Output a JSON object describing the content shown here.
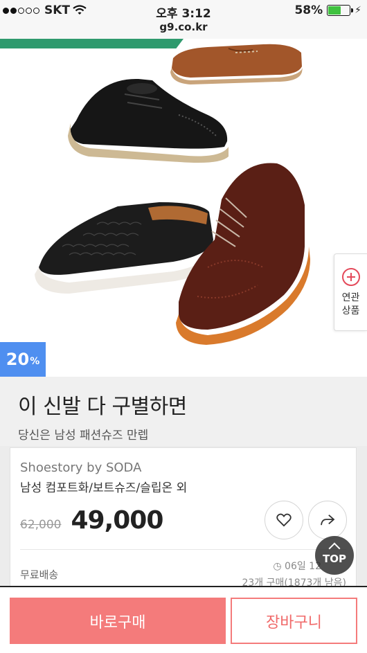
{
  "status_bar": {
    "carrier": "SKT",
    "time": "오후 3:12",
    "battery_percent": "58%",
    "battery_level": 0.58,
    "signal_bars": 2
  },
  "browser": {
    "url": "g9.co.kr"
  },
  "hero": {
    "discount_value": "20",
    "discount_unit": "%",
    "related_tab": {
      "line1": "연관",
      "line2": "상품",
      "icon": "plus-circle-icon"
    }
  },
  "title": {
    "main": "이 신발 다 구별하면",
    "sub": "당신은 남성 패션슈즈 만렙"
  },
  "product": {
    "brand": "Shoestory by SODA",
    "description": "남성 컴포트화/보트슈즈/슬립온 외",
    "original_price": "62,000",
    "sale_price": "49,000",
    "shipping": "무료배송",
    "time_left": "06일 12",
    "purchase_info": "23개 구매(1873개 남음)",
    "like_icon": "heart-icon",
    "share_icon": "share-arrow-icon"
  },
  "top_button": {
    "label": "TOP"
  },
  "actions": {
    "buy_now": "바로구매",
    "cart": "장바구니"
  },
  "colors": {
    "accent_red": "#f47b7b",
    "badge_blue": "#4f8ff0",
    "strip_green": "#2f9a6e",
    "related_red": "#e4495a"
  }
}
